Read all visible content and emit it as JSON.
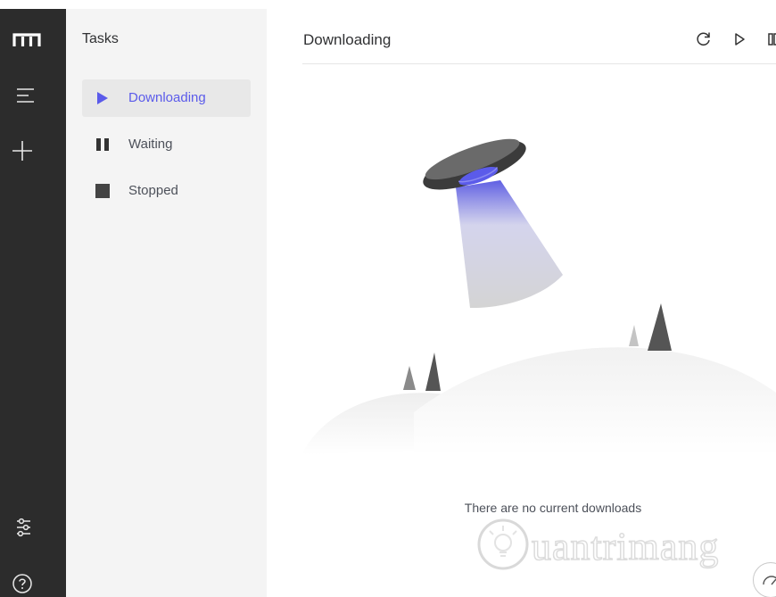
{
  "nav_rail": {
    "items": [
      {
        "icon": "logo-m-icon"
      },
      {
        "icon": "menu-lines-icon"
      },
      {
        "icon": "plus-icon"
      },
      {
        "icon": "sliders-settings-icon"
      },
      {
        "icon": "help-circle-icon"
      }
    ]
  },
  "sidebar": {
    "title": "Tasks",
    "items": [
      {
        "label": "Downloading",
        "icon": "play-icon",
        "active": true
      },
      {
        "label": "Waiting",
        "icon": "pause-icon",
        "active": false
      },
      {
        "label": "Stopped",
        "icon": "stop-icon",
        "active": false
      }
    ]
  },
  "main": {
    "title": "Downloading",
    "actions": [
      {
        "icon": "refresh-icon"
      },
      {
        "icon": "play-outline-icon"
      },
      {
        "icon": "pause-outline-icon"
      }
    ],
    "empty_text": "There are no current downloads"
  },
  "watermark": {
    "text": "Quantrimang"
  },
  "colors": {
    "rail_bg": "#2c2c2c",
    "sidebar_bg": "#f4f4f4",
    "active_item_bg": "#e8e8e8",
    "accent": "#5b5bea"
  }
}
